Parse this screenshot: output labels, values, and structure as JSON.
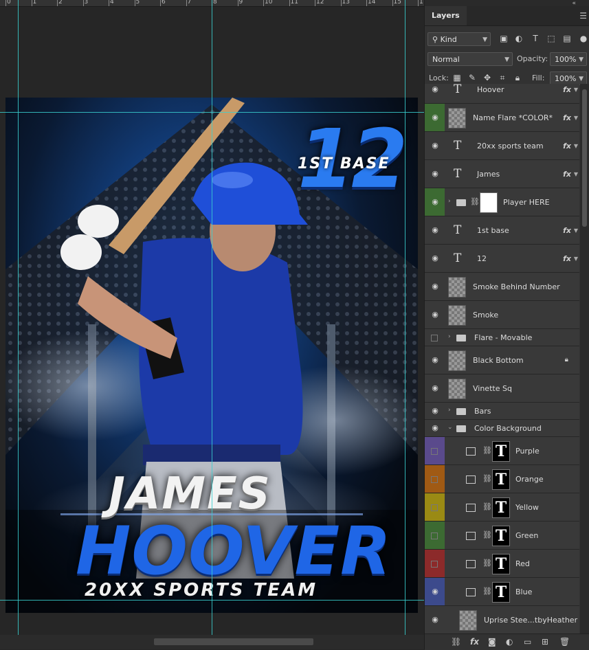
{
  "ruler": {
    "numbers": [
      "0",
      "1",
      "2",
      "3",
      "4",
      "5",
      "6",
      "7",
      "8",
      "9",
      "10",
      "11",
      "12",
      "13",
      "14",
      "15",
      "1"
    ]
  },
  "poster": {
    "first_name": "JAMES",
    "last_name": "HOOVER",
    "team": "20XX SPORTS TEAM",
    "number": "12",
    "position": "1ST BASE"
  },
  "panel": {
    "tab_label": "Layers",
    "filter_kind": "Kind",
    "blend_mode": "Normal",
    "opacity_label": "Opacity:",
    "opacity_value": "100%",
    "lock_label": "Lock:",
    "fill_label": "Fill:",
    "fill_value": "100%"
  },
  "colors": {
    "purple": "#5a4a8c",
    "orange": "#a05a14",
    "yellow": "#9a8a14",
    "green": "#3c6a32",
    "red": "#8c2a2a",
    "blue": "#3c4a8c",
    "selected_green": "#4a7a3a"
  },
  "layers": [
    {
      "name": "Hoover",
      "kind": "text",
      "fx": true
    },
    {
      "name": "Name Flare *COLOR*",
      "kind": "pixel",
      "fx": true,
      "tag": "green"
    },
    {
      "name": "20xx sports team",
      "kind": "text",
      "fx": true
    },
    {
      "name": "James",
      "kind": "text",
      "fx": true
    },
    {
      "name": "Player HERE",
      "kind": "group-mask",
      "tag": "green"
    },
    {
      "name": "1st base",
      "kind": "text",
      "fx": true
    },
    {
      "name": "12",
      "kind": "text",
      "fx": true
    },
    {
      "name": "Smoke Behind Number",
      "kind": "pixel"
    },
    {
      "name": "Smoke",
      "kind": "pixel"
    },
    {
      "name": "Flare - Movable",
      "kind": "group",
      "hidden": true
    },
    {
      "name": "Black Bottom",
      "kind": "pixel",
      "locked": true
    },
    {
      "name": "Vinette Sq",
      "kind": "pixel"
    },
    {
      "name": "Bars",
      "kind": "group"
    },
    {
      "name": "Color Background",
      "kind": "group-open"
    },
    {
      "name": "Purple",
      "kind": "adjust",
      "tag": "purple",
      "hidden": true
    },
    {
      "name": "Orange",
      "kind": "adjust",
      "tag": "orange",
      "hidden": true
    },
    {
      "name": "Yellow",
      "kind": "adjust",
      "tag": "yellow",
      "hidden": true
    },
    {
      "name": "Green",
      "kind": "adjust",
      "tag": "green",
      "hidden": true
    },
    {
      "name": "Red",
      "kind": "adjust",
      "tag": "red",
      "hidden": true
    },
    {
      "name": "Blue",
      "kind": "adjust",
      "tag": "blue"
    },
    {
      "name": "Uprise Stee...tbyHeather",
      "kind": "base"
    }
  ],
  "footer_icons": [
    "link-icon",
    "fx-icon",
    "mask-icon",
    "adjustment-icon",
    "folder-icon",
    "new-layer-icon",
    "trash-icon"
  ]
}
